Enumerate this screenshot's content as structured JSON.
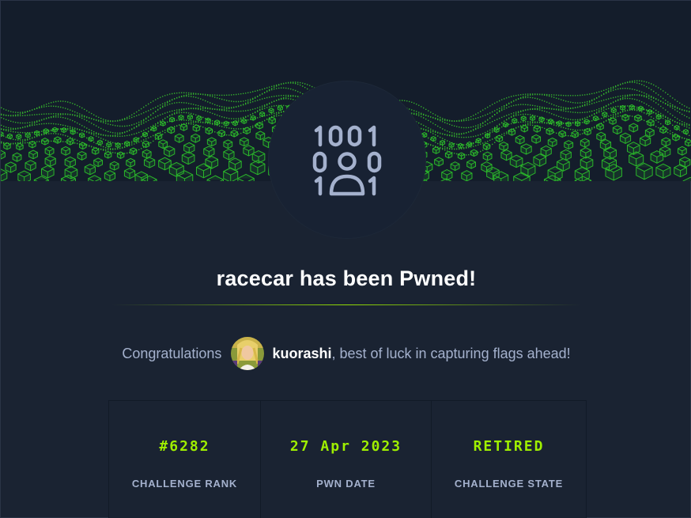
{
  "title": "racecar has been Pwned!",
  "congrats": {
    "prefix": "Congratulations",
    "username": "kuorashi",
    "suffix": ", best of luck in capturing flags ahead!"
  },
  "stats": [
    {
      "value": "#6282",
      "label": "CHALLENGE RANK"
    },
    {
      "value": "27 Apr 2023",
      "label": "PWN DATE"
    },
    {
      "value": "RETIRED",
      "label": "CHALLENGE STATE"
    }
  ],
  "badge": {
    "icon": "binary-user-icon"
  },
  "colors": {
    "background": "#1a2332",
    "accent": "#9fef00",
    "muted_text": "#a4b1cd",
    "badge_icon": "#a4b1cd"
  }
}
